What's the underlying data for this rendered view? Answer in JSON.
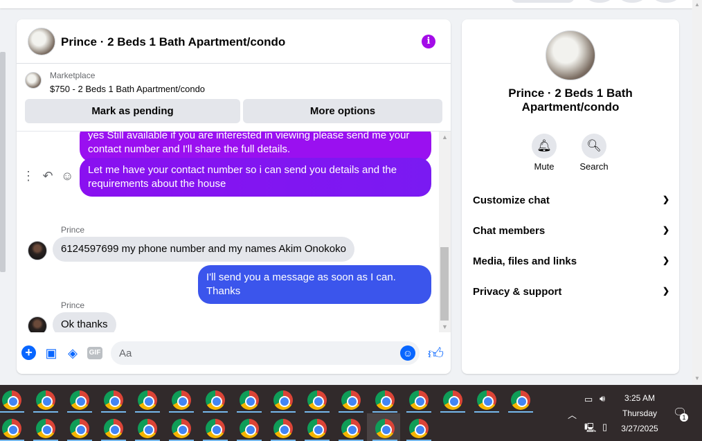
{
  "chat": {
    "title": "Prince · 2 Beds 1 Bath Apartment/condo",
    "marketplace": {
      "label": "Marketplace",
      "item": "$750 - 2 Beds 1 Bath Apartment/condo",
      "pending_button": "Mark as pending",
      "more_button": "More options"
    },
    "messages": [
      {
        "direction": "out",
        "text": "yes Still available if you are interested in viewing please send me your contact number and I'll share the full details."
      },
      {
        "direction": "out",
        "text": "Let me have your contact number so i can send you details and the requirements about the house"
      },
      {
        "direction": "in",
        "sender": "Prince",
        "text": "6124597699 my phone number and my names Akim Onokoko"
      },
      {
        "direction": "out",
        "text": "I'll send you a message as soon as I can. Thanks"
      },
      {
        "direction": "in",
        "sender": "Prince",
        "text": "Ok thanks"
      }
    ],
    "composer": {
      "placeholder": "Aa",
      "gif_label": "GIF"
    }
  },
  "info_panel": {
    "title": "Prince · 2 Beds 1 Bath Apartment/condo",
    "actions": [
      {
        "label": "Mute",
        "icon": "bell-icon"
      },
      {
        "label": "Search",
        "icon": "search-icon"
      }
    ],
    "sections": [
      "Customize chat",
      "Chat members",
      "Media, files and links",
      "Privacy & support"
    ]
  },
  "taskbar": {
    "time": "3:25 AM",
    "day": "Thursday",
    "date": "3/27/2025",
    "notification_count": "1"
  },
  "colors": {
    "accent": "#a30be8",
    "bubble_purple": "#8a10f0",
    "bubble_blue": "#3b55ec",
    "messenger_blue": "#0866ff",
    "taskbar": "#312a2b"
  }
}
